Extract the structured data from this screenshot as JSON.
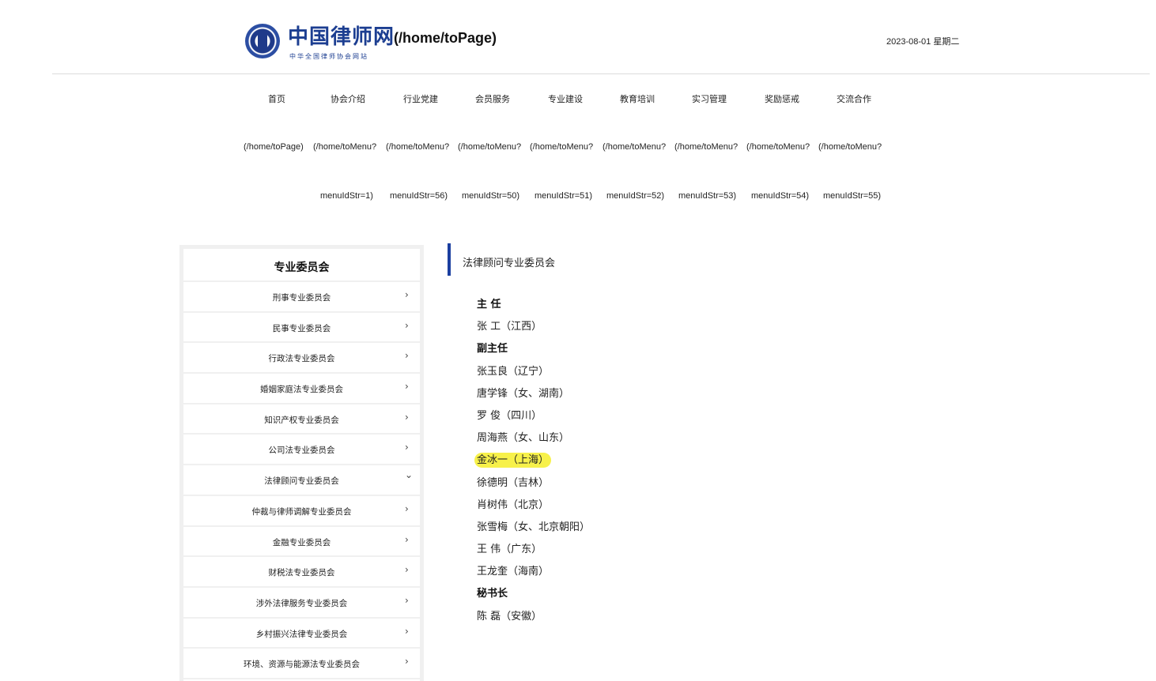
{
  "header": {
    "logo_title": "中国律师网",
    "logo_subtitle": "中华全国律师协会网站",
    "home_link": "(/home/toPage)",
    "date": "2023-08-01 星期二"
  },
  "nav": {
    "items": [
      "首页",
      "协会介绍",
      "行业党建",
      "会员服务",
      "专业建设",
      "教育培训",
      "实习管理",
      "奖励惩戒",
      "交流合作"
    ],
    "urls": [
      "(/home/toPage)",
      "(/home/toMenu?",
      "(/home/toMenu?",
      "(/home/toMenu?",
      "(/home/toMenu?",
      "(/home/toMenu?",
      "(/home/toMenu?",
      "(/home/toMenu?",
      "(/home/toMenu?"
    ],
    "params": [
      "menuIdStr=1)",
      "menuIdStr=56)",
      "menuIdStr=50)",
      "menuIdStr=51)",
      "menuIdStr=52)",
      "menuIdStr=53)",
      "menuIdStr=54)",
      "menuIdStr=55)"
    ]
  },
  "sidebar": {
    "title": "专业委员会",
    "chevron_closed": "›",
    "chevron_open": "⌄",
    "items": [
      {
        "label": "刑事专业委员会"
      },
      {
        "label": "民事专业委员会"
      },
      {
        "label": "行政法专业委员会"
      },
      {
        "label": "婚姻家庭法专业委员会"
      },
      {
        "label": "知识产权专业委员会"
      },
      {
        "label": "公司法专业委员会"
      },
      {
        "label": "法律顾问专业委员会"
      },
      {
        "label": "仲裁与律师调解专业委员会"
      },
      {
        "label": "金融专业委员会"
      },
      {
        "label": "财税法专业委员会"
      },
      {
        "label": "涉外法律服务专业委员会"
      },
      {
        "label": "乡村振兴法律专业委员会"
      },
      {
        "label": "环境、资源与能源法专业委员会"
      }
    ]
  },
  "content": {
    "title": "法律顾问专业委员会",
    "lines": [
      {
        "text": "主  任",
        "role": true
      },
      {
        "text": "张  工（江西）"
      },
      {
        "text": "副主任",
        "role": true
      },
      {
        "text": "张玉良（辽宁）"
      },
      {
        "text": "唐学锋（女、湖南）"
      },
      {
        "text": "罗  俊（四川）"
      },
      {
        "text": "周海燕（女、山东）"
      },
      {
        "text": "金冰一（上海）",
        "highlight": true
      },
      {
        "text": "徐德明（吉林）"
      },
      {
        "text": "肖树伟（北京）"
      },
      {
        "text": "张雪梅（女、北京朝阳）"
      },
      {
        "text": "王  伟（广东）"
      },
      {
        "text": "王龙奎（海南）"
      },
      {
        "text": "秘书长",
        "role": true
      },
      {
        "text": "陈  磊（安徽）"
      }
    ],
    "highlight_color": "#f7f14a"
  }
}
